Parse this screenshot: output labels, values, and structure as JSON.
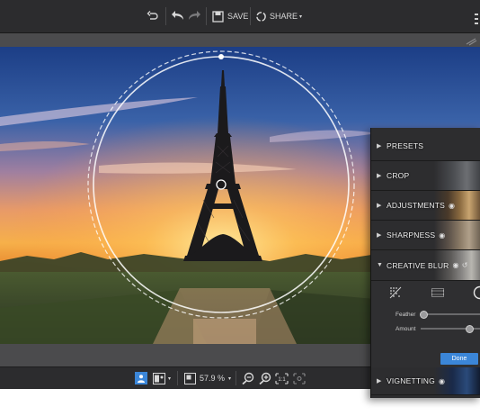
{
  "toolbar": {
    "undo_icon": "undo-icon",
    "back_icon": "back-arrow-icon",
    "forward_icon": "forward-arrow-icon",
    "save_label": "SAVE",
    "share_label": "SHARE"
  },
  "zoom": {
    "value": "57.9 %"
  },
  "panel": {
    "items": [
      {
        "label": "PRESETS",
        "expanded": false,
        "eye": false
      },
      {
        "label": "CROP",
        "expanded": false,
        "eye": false
      },
      {
        "label": "ADJUSTMENTS",
        "expanded": false,
        "eye": true
      },
      {
        "label": "SHARPNESS",
        "expanded": false,
        "eye": true
      },
      {
        "label": "CREATIVE BLUR",
        "expanded": true,
        "eye": true
      },
      {
        "label": "VIGNETTING",
        "expanded": false,
        "eye": true
      }
    ],
    "blur": {
      "feather_label": "Feather",
      "amount_label": "Amount",
      "feather_value": 0.05,
      "amount_value": 0.8,
      "done_label": "Done"
    }
  },
  "colors": {
    "accent": "#3b86d8",
    "bar": "#2c2c2e",
    "panel": "#2d2d2f"
  }
}
